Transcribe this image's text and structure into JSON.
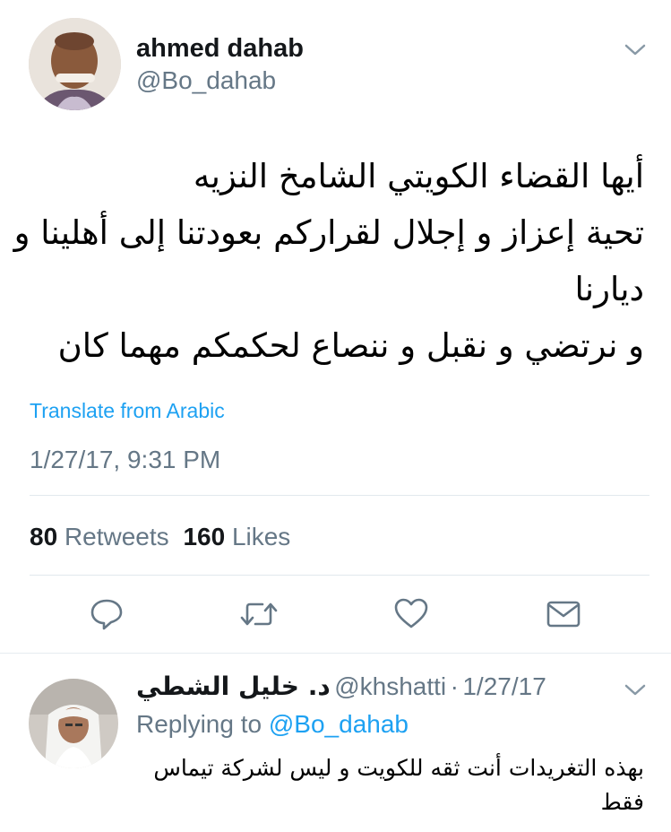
{
  "tweet": {
    "author_name": "ahmed dahab",
    "author_handle": "@Bo_dahab",
    "text_lines": [
      "أيها القضاء الكويتي الشامخ النزيه",
      "تحية إعزاز و إجلال لقراركم بعودتنا إلى أهلينا و",
      "ديارنا",
      "و نرتضي و نقبل و ننصاع لحكمكم مهما كان"
    ],
    "translate_label": "Translate from Arabic",
    "timestamp": "1/27/17, 9:31 PM",
    "stats": {
      "retweets_count": "80",
      "retweets_label": "Retweets",
      "likes_count": "160",
      "likes_label": "Likes"
    },
    "menu_icon": "chevron-down-icon"
  },
  "actions": {
    "reply_icon": "comment-icon",
    "retweet_icon": "retweet-icon",
    "like_icon": "heart-icon",
    "message_icon": "envelope-icon"
  },
  "reply": {
    "author_name": "د. خليل الشطي",
    "author_handle": "@khshatti",
    "separator": "·",
    "date": "1/27/17",
    "replying_prefix": "Replying to",
    "replying_handle": "@Bo_dahab",
    "text_lines": [
      "بهذه التغريدات أنت ثقه للكويت و ليس لشركة تيماس",
      "فقط"
    ]
  },
  "colors": {
    "link": "#1da1f2",
    "secondary_text": "#657786",
    "divider": "#e1e8ed"
  }
}
